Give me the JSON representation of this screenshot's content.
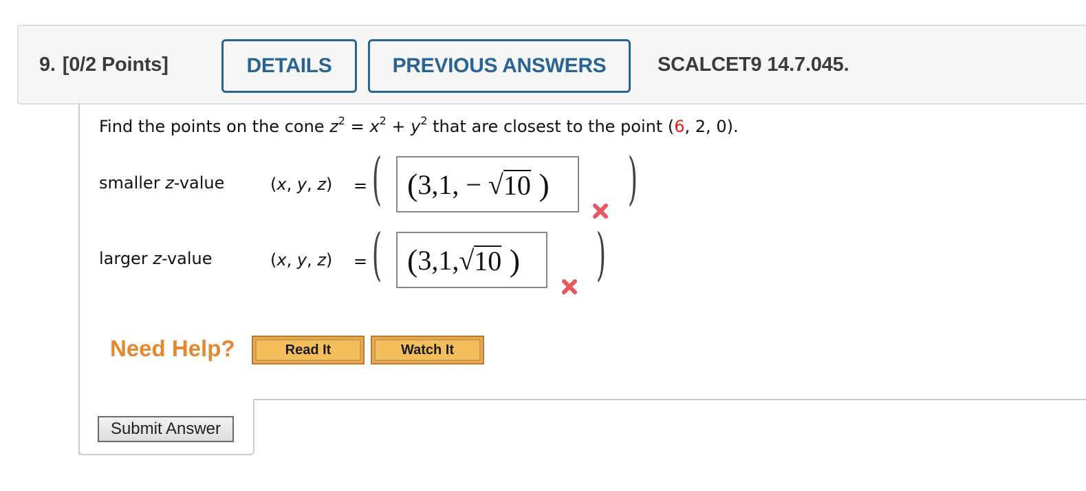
{
  "question": {
    "number": "9.",
    "points": "[0/2 Points]",
    "details_label": "DETAILS",
    "previous_answers_label": "PREVIOUS ANSWERS",
    "code": "SCALCET9 14.7.045."
  },
  "prompt": {
    "text_before": "Find the points on the cone ",
    "var_z": "z",
    "exp": "2",
    "equals": " = ",
    "var_x": "x",
    "plus": " + ",
    "var_y": "y",
    "text_after": " that are closest to the point (",
    "highlight_value": "6",
    "text_end": ", 2, 0)."
  },
  "answers": [
    {
      "label_pre": "smaller ",
      "label_var": "z",
      "label_post": "-value",
      "tuple_open": "(",
      "tuple_x": "x",
      "tuple_y": "y",
      "tuple_z": "z",
      "tuple_close": ")",
      "sep": ", ",
      "equals": "=",
      "entered_prefix": "3,1, − √",
      "entered_radicand": "10",
      "status": "incorrect",
      "status_color": "#e4474b"
    },
    {
      "label_pre": "larger ",
      "label_var": "z",
      "label_post": "-value",
      "tuple_open": "(",
      "tuple_x": "x",
      "tuple_y": "y",
      "tuple_z": "z",
      "tuple_close": ")",
      "sep": ", ",
      "equals": "=",
      "entered_prefix": "3,1,√",
      "entered_radicand": "10",
      "status": "incorrect",
      "status_color": "#e4474b"
    }
  ],
  "help": {
    "label": "Need Help?",
    "read_it": "Read It",
    "watch_it": "Watch It"
  },
  "submit": {
    "label": "Submit Answer"
  },
  "colors": {
    "accent_blue": "#2a6496",
    "help_orange": "#e5892f",
    "highlight_red": "#e02020",
    "wrong_red": "#e4474b"
  }
}
